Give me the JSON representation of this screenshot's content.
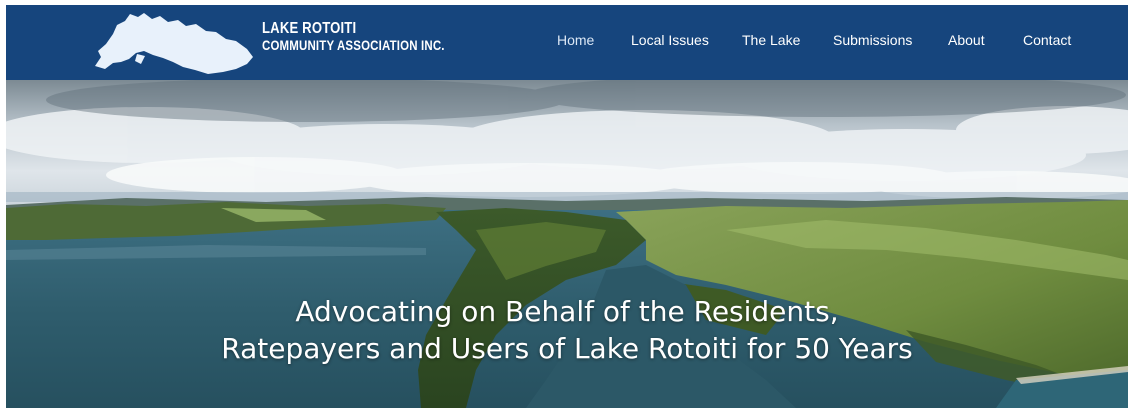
{
  "brand": {
    "line1": "LAKE ROTOITI",
    "line2": "COMMUNITY ASSOCIATION INC.",
    "logo_icon": "lake-outline-icon"
  },
  "nav": {
    "items": [
      {
        "label": "Home",
        "active": true
      },
      {
        "label": "Local Issues",
        "active": false
      },
      {
        "label": "The Lake",
        "active": false
      },
      {
        "label": "Submissions",
        "active": false
      },
      {
        "label": "About",
        "active": false
      },
      {
        "label": "Contact",
        "active": false
      }
    ]
  },
  "hero": {
    "line1": "Advocating on Behalf of the Residents,",
    "line2": "Ratepayers and Users of Lake Rotoiti for 50 Years",
    "image": "aerial-lake-photo"
  },
  "colors": {
    "nav_bg": "#16457d",
    "nav_text": "#ffffff",
    "hero_text": "#ffffff",
    "logo_fill": "#e8f1fb"
  }
}
